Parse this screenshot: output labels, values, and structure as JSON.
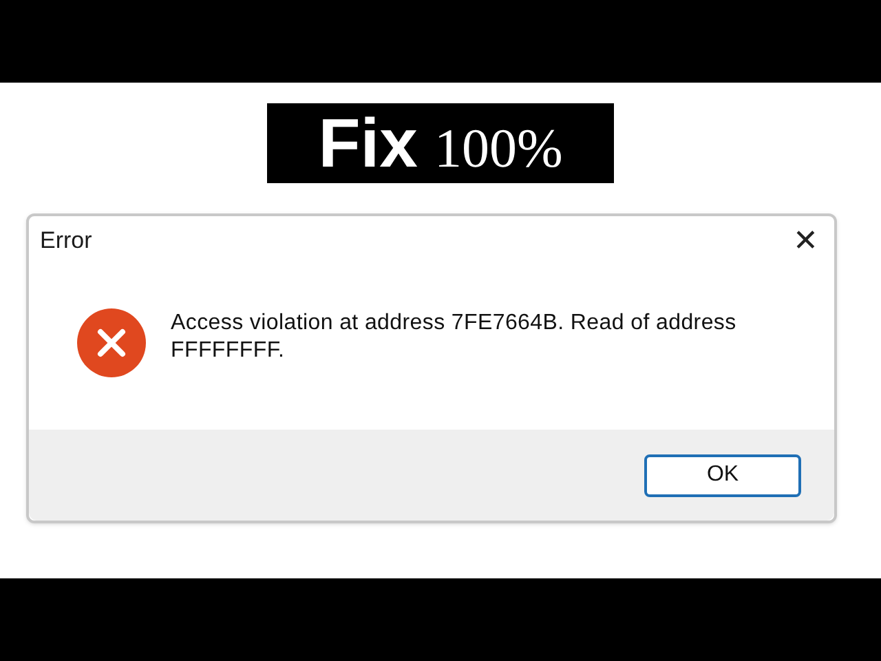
{
  "banner": {
    "headline": "Fix",
    "tagline": "100%"
  },
  "dialog": {
    "title": "Error",
    "close": "✕",
    "message": "Access violation at address 7FE7664B. Read of address FFFFFFFF.",
    "buttons": [
      "OK"
    ]
  }
}
